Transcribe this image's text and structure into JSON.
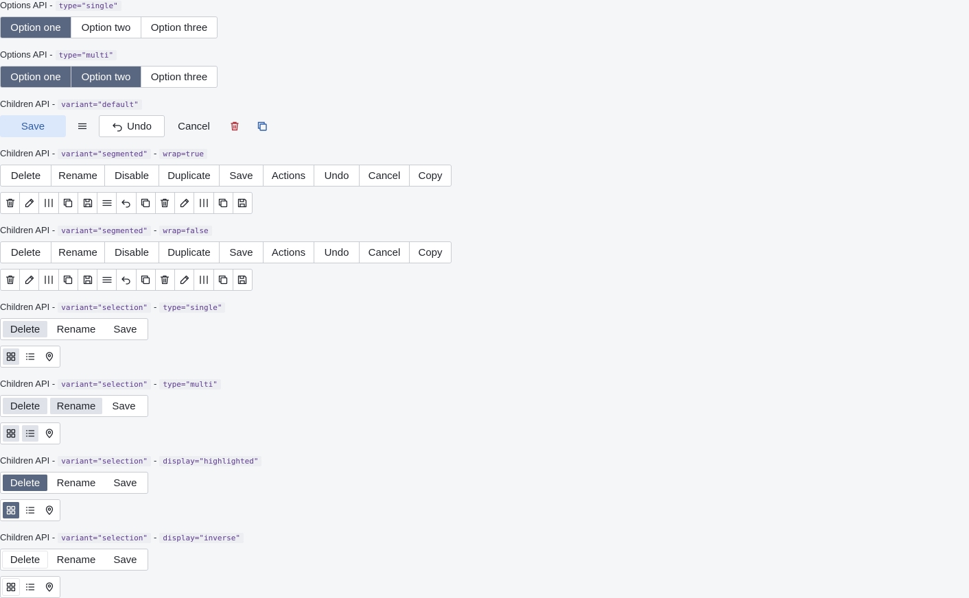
{
  "sections": {
    "s1": {
      "prefix": "Options API -",
      "code1": "type=\"single\"",
      "opts": [
        "Option one",
        "Option two",
        "Option three"
      ]
    },
    "s2": {
      "prefix": "Options API -",
      "code1": "type=\"multi\"",
      "opts": [
        "Option one",
        "Option two",
        "Option three"
      ]
    },
    "s3": {
      "prefix": "Children API -",
      "code1": "variant=\"default\"",
      "save": "Save",
      "undo": "Undo",
      "cancel": "Cancel"
    },
    "s4": {
      "prefix": "Children API -",
      "code1": "variant=\"segmented\"",
      "dash": "-",
      "code2": "wrap=true"
    },
    "s5": {
      "prefix": "Children API -",
      "code1": "variant=\"segmented\"",
      "dash": "-",
      "code2": "wrap=false"
    },
    "s6": {
      "prefix": "Children API -",
      "code1": "variant=\"selection\"",
      "dash": "-",
      "code2": "type=\"single\""
    },
    "s7": {
      "prefix": "Children API -",
      "code1": "variant=\"selection\"",
      "dash": "-",
      "code2": "type=\"multi\""
    },
    "s8": {
      "prefix": "Children API -",
      "code1": "variant=\"selection\"",
      "dash": "-",
      "code2": "display=\"highlighted\""
    },
    "s9": {
      "prefix": "Children API -",
      "code1": "variant=\"selection\"",
      "dash": "-",
      "code2": "display=\"inverse\""
    }
  },
  "segmented_labels": [
    "Delete",
    "Rename",
    "Disable",
    "Duplicate",
    "Save",
    "Actions",
    "Undo",
    "Cancel",
    "Copy"
  ],
  "selection_labels": [
    "Delete",
    "Rename",
    "Save"
  ],
  "icon_row": [
    "trash-icon",
    "pencil-icon",
    "columns-icon",
    "copy-icon",
    "save-icon",
    "menu-icon",
    "undo-icon",
    "copy-icon",
    "trash-icon",
    "pencil-icon",
    "columns-icon",
    "copy-icon",
    "save-icon"
  ],
  "view_icons": [
    "grid-icon",
    "list-icon",
    "location-pin-icon"
  ],
  "colors": {
    "selected": "#5a6780",
    "save_bg": "#dbe8fb",
    "save_text": "#2f5ea8",
    "danger": "#b8323c",
    "copy_blue": "#2f5ea8"
  }
}
